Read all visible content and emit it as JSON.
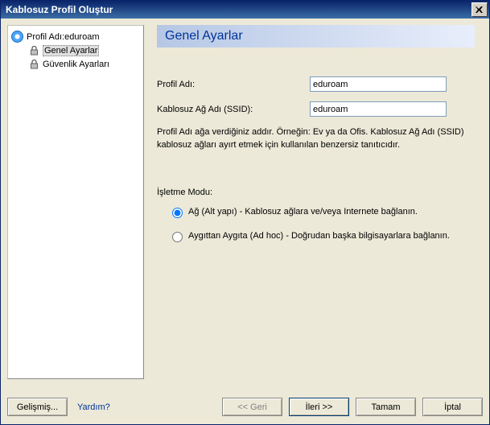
{
  "window": {
    "title": "Kablosuz Profil Oluştur"
  },
  "tree": {
    "root_label": "Profil Adı:eduroam",
    "items": [
      {
        "label": "Genel Ayarlar",
        "selected": true
      },
      {
        "label": "Güvenlik Ayarları",
        "selected": false
      }
    ]
  },
  "section": {
    "heading": "Genel Ayarlar"
  },
  "form": {
    "profile_name_label": "Profil Adı:",
    "profile_name_value": "eduroam",
    "ssid_label": "Kablosuz Ağ Adı  (SSID):",
    "ssid_value": "eduroam",
    "description": "Profil Adı ağa verdiğiniz addır. Örneğin: Ev ya da Ofis. Kablosuz Ağ Adı (SSID) kablosuz ağları ayırt etmek için kullanılan benzersiz tanıtıcıdır."
  },
  "operating_mode": {
    "title": "İşletme Modu:",
    "options": [
      {
        "label": "Ağ (Alt yapı) - Kablosuz ağlara ve/veya Internete bağlanın.",
        "checked": true
      },
      {
        "label": "Aygıttan Aygıta (Ad hoc) - Doğrudan başka bilgisayarlara bağlanın.",
        "checked": false
      }
    ]
  },
  "buttons": {
    "advanced": "Gelişmiş...",
    "help": "Yardım?",
    "back": "<< Geri",
    "next": "İleri >>",
    "ok": "Tamam",
    "cancel": "İptal"
  }
}
